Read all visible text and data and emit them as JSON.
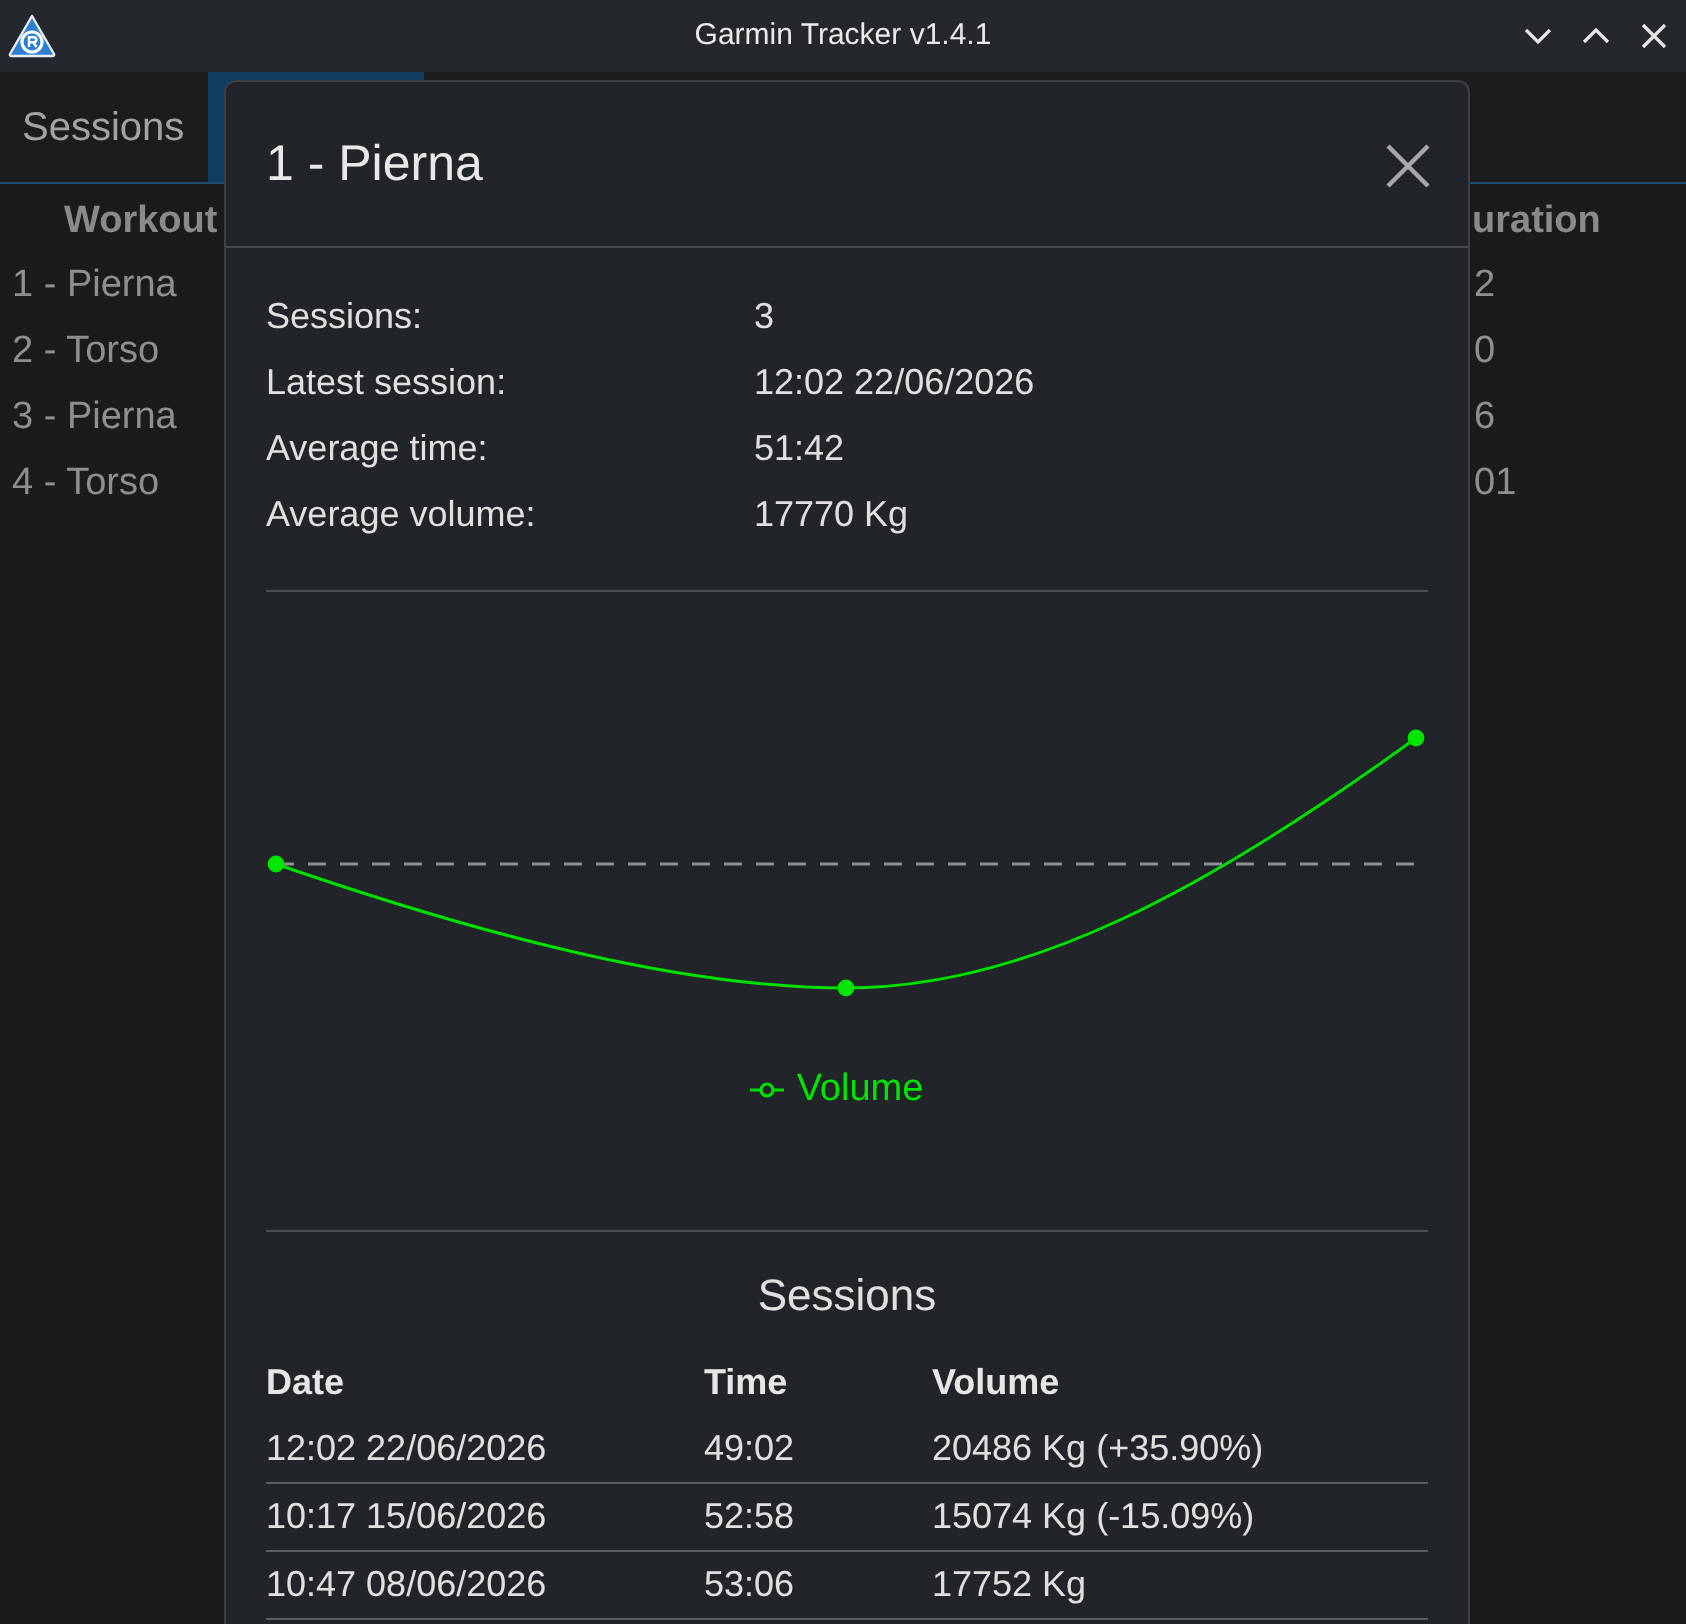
{
  "window": {
    "title": "Garmin Tracker v1.4.1"
  },
  "tabs": [
    {
      "label": "Sessions",
      "selected": false
    },
    {
      "selected": true
    }
  ],
  "background_table": {
    "columns": [
      "Workout",
      "uration"
    ],
    "rows": [
      {
        "cells": [
          "1 - Pierna",
          "2"
        ]
      },
      {
        "cells": [
          "2 - Torso",
          "0"
        ]
      },
      {
        "cells": [
          "3 - Pierna",
          "6"
        ]
      },
      {
        "cells": [
          "4 - Torso",
          "01"
        ]
      }
    ]
  },
  "dialog": {
    "title": "1 - Pierna",
    "stats": [
      {
        "label": "Sessions:",
        "value": "3"
      },
      {
        "label": "Latest session:",
        "value": "12:02 22/06/2026"
      },
      {
        "label": "Average time:",
        "value": "51:42"
      },
      {
        "label": "Average volume:",
        "value": "17770 Kg"
      }
    ],
    "chart": {
      "legend_label": "Volume"
    },
    "sessions_heading": "Sessions",
    "sessions_table": {
      "columns": [
        "Date",
        "Time",
        "Volume"
      ],
      "rows": [
        {
          "cells": [
            "12:02 22/06/2026",
            "49:02",
            "20486 Kg (+35.90%)"
          ]
        },
        {
          "cells": [
            "10:17 15/06/2026",
            "52:58",
            "15074 Kg (-15.09%)"
          ]
        },
        {
          "cells": [
            "10:47 08/06/2026",
            "53:06",
            "17752 Kg"
          ]
        }
      ]
    }
  }
}
